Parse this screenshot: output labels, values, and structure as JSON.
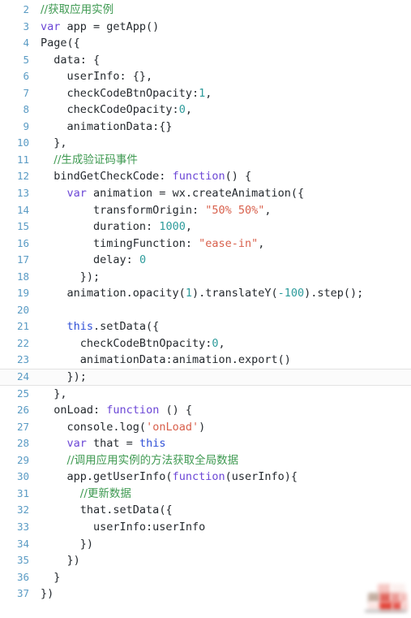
{
  "editor": {
    "title": "code-editor-pane",
    "language": "javascript",
    "gutter_color": "#5a9bc4",
    "background": "#ffffff",
    "current_line": 24,
    "first_visible_line": 2,
    "last_visible_line": 37,
    "colors": {
      "comment": "#3f9a52",
      "keyword": "#6b46d6",
      "this_keyword": "#2f4fd6",
      "string": "#d8604c",
      "number": "#2d9b9b",
      "plain": "#24292e",
      "line_number": "#5a9bc4",
      "current_line_bg": "#fbfbfb",
      "current_line_border": "#e3e3e3"
    },
    "lines": [
      {
        "n": "2",
        "indent": 0,
        "tokens": [
          {
            "t": "//获取应用实例",
            "c": "comment",
            "cjk": true
          }
        ]
      },
      {
        "n": "3",
        "indent": 0,
        "tokens": [
          {
            "t": "var",
            "c": "keyword"
          },
          {
            "t": " app = getApp()",
            "c": "plain"
          }
        ]
      },
      {
        "n": "4",
        "indent": 0,
        "tokens": [
          {
            "t": "Page({",
            "c": "plain"
          }
        ]
      },
      {
        "n": "5",
        "indent": 1,
        "tokens": [
          {
            "t": "data: {",
            "c": "plain"
          }
        ]
      },
      {
        "n": "6",
        "indent": 2,
        "tokens": [
          {
            "t": "userInfo: {},",
            "c": "plain"
          }
        ]
      },
      {
        "n": "7",
        "indent": 2,
        "tokens": [
          {
            "t": "checkCodeBtnOpacity:",
            "c": "plain"
          },
          {
            "t": "1",
            "c": "number"
          },
          {
            "t": ",",
            "c": "plain"
          }
        ]
      },
      {
        "n": "8",
        "indent": 2,
        "tokens": [
          {
            "t": "checkCodeOpacity:",
            "c": "plain"
          },
          {
            "t": "0",
            "c": "number"
          },
          {
            "t": ",",
            "c": "plain"
          }
        ]
      },
      {
        "n": "9",
        "indent": 2,
        "tokens": [
          {
            "t": "animationData:{}",
            "c": "plain"
          }
        ]
      },
      {
        "n": "10",
        "indent": 1,
        "tokens": [
          {
            "t": "},",
            "c": "plain"
          }
        ]
      },
      {
        "n": "11",
        "indent": 1,
        "tokens": [
          {
            "t": "//生成验证码事件",
            "c": "comment",
            "cjk": true
          }
        ]
      },
      {
        "n": "12",
        "indent": 1,
        "tokens": [
          {
            "t": "bindGetCheckCode: ",
            "c": "plain"
          },
          {
            "t": "function",
            "c": "keyword"
          },
          {
            "t": "() {",
            "c": "plain"
          }
        ]
      },
      {
        "n": "13",
        "indent": 2,
        "tokens": [
          {
            "t": "var",
            "c": "keyword"
          },
          {
            "t": " animation = wx.createAnimation({",
            "c": "plain"
          }
        ]
      },
      {
        "n": "14",
        "indent": 4,
        "tokens": [
          {
            "t": "transformOrigin: ",
            "c": "plain"
          },
          {
            "t": "\"50% 50%\"",
            "c": "string"
          },
          {
            "t": ",",
            "c": "plain"
          }
        ]
      },
      {
        "n": "15",
        "indent": 4,
        "tokens": [
          {
            "t": "duration: ",
            "c": "plain"
          },
          {
            "t": "1000",
            "c": "number"
          },
          {
            "t": ",",
            "c": "plain"
          }
        ]
      },
      {
        "n": "16",
        "indent": 4,
        "tokens": [
          {
            "t": "timingFunction: ",
            "c": "plain"
          },
          {
            "t": "\"ease-in\"",
            "c": "string"
          },
          {
            "t": ",",
            "c": "plain"
          }
        ]
      },
      {
        "n": "17",
        "indent": 4,
        "tokens": [
          {
            "t": "delay: ",
            "c": "plain"
          },
          {
            "t": "0",
            "c": "number"
          }
        ]
      },
      {
        "n": "18",
        "indent": 3,
        "tokens": [
          {
            "t": "});",
            "c": "plain"
          }
        ]
      },
      {
        "n": "19",
        "indent": 2,
        "tokens": [
          {
            "t": "animation.opacity(",
            "c": "plain"
          },
          {
            "t": "1",
            "c": "number"
          },
          {
            "t": ").translateY(",
            "c": "plain"
          },
          {
            "t": "-100",
            "c": "number"
          },
          {
            "t": ").step();",
            "c": "plain"
          }
        ]
      },
      {
        "n": "20",
        "indent": 0,
        "tokens": [
          {
            "t": "",
            "c": "plain"
          }
        ]
      },
      {
        "n": "21",
        "indent": 2,
        "tokens": [
          {
            "t": "this",
            "c": "this"
          },
          {
            "t": ".setData({",
            "c": "plain"
          }
        ]
      },
      {
        "n": "22",
        "indent": 3,
        "tokens": [
          {
            "t": "checkCodeBtnOpacity:",
            "c": "plain"
          },
          {
            "t": "0",
            "c": "number"
          },
          {
            "t": ",",
            "c": "plain"
          }
        ]
      },
      {
        "n": "23",
        "indent": 3,
        "tokens": [
          {
            "t": "animationData:animation.export()",
            "c": "plain"
          }
        ]
      },
      {
        "n": "24",
        "indent": 2,
        "current": true,
        "tokens": [
          {
            "t": "});",
            "c": "plain"
          }
        ]
      },
      {
        "n": "25",
        "indent": 1,
        "tokens": [
          {
            "t": "},",
            "c": "plain"
          }
        ]
      },
      {
        "n": "26",
        "indent": 1,
        "tokens": [
          {
            "t": "onLoad: ",
            "c": "plain"
          },
          {
            "t": "function",
            "c": "keyword"
          },
          {
            "t": " () {",
            "c": "plain"
          }
        ]
      },
      {
        "n": "27",
        "indent": 2,
        "tokens": [
          {
            "t": "console.log(",
            "c": "plain"
          },
          {
            "t": "'onLoad'",
            "c": "string"
          },
          {
            "t": ")",
            "c": "plain"
          }
        ]
      },
      {
        "n": "28",
        "indent": 2,
        "tokens": [
          {
            "t": "var",
            "c": "keyword"
          },
          {
            "t": " that = ",
            "c": "plain"
          },
          {
            "t": "this",
            "c": "this"
          }
        ]
      },
      {
        "n": "29",
        "indent": 2,
        "tokens": [
          {
            "t": "//调用应用实例的方法获取全局数据",
            "c": "comment",
            "cjk": true
          }
        ]
      },
      {
        "n": "30",
        "indent": 2,
        "tokens": [
          {
            "t": "app.getUserInfo(",
            "c": "plain"
          },
          {
            "t": "function",
            "c": "keyword"
          },
          {
            "t": "(userInfo){",
            "c": "plain"
          }
        ]
      },
      {
        "n": "31",
        "indent": 3,
        "tokens": [
          {
            "t": "//更新数据",
            "c": "comment",
            "cjk": true
          }
        ]
      },
      {
        "n": "32",
        "indent": 3,
        "tokens": [
          {
            "t": "that.setData({",
            "c": "plain"
          }
        ]
      },
      {
        "n": "33",
        "indent": 4,
        "tokens": [
          {
            "t": "userInfo:userInfo",
            "c": "plain"
          }
        ]
      },
      {
        "n": "34",
        "indent": 3,
        "tokens": [
          {
            "t": "})",
            "c": "plain"
          }
        ]
      },
      {
        "n": "35",
        "indent": 2,
        "tokens": [
          {
            "t": "})",
            "c": "plain"
          }
        ]
      },
      {
        "n": "36",
        "indent": 1,
        "tokens": [
          {
            "t": "}",
            "c": "plain"
          }
        ]
      },
      {
        "n": "37",
        "indent": 0,
        "tokens": [
          {
            "t": "})",
            "c": "plain"
          }
        ]
      }
    ]
  },
  "watermark": {
    "label": "blurred-logo-watermark",
    "primary_color": "#e34a3e",
    "secondary_color": "#f3bdb9"
  }
}
